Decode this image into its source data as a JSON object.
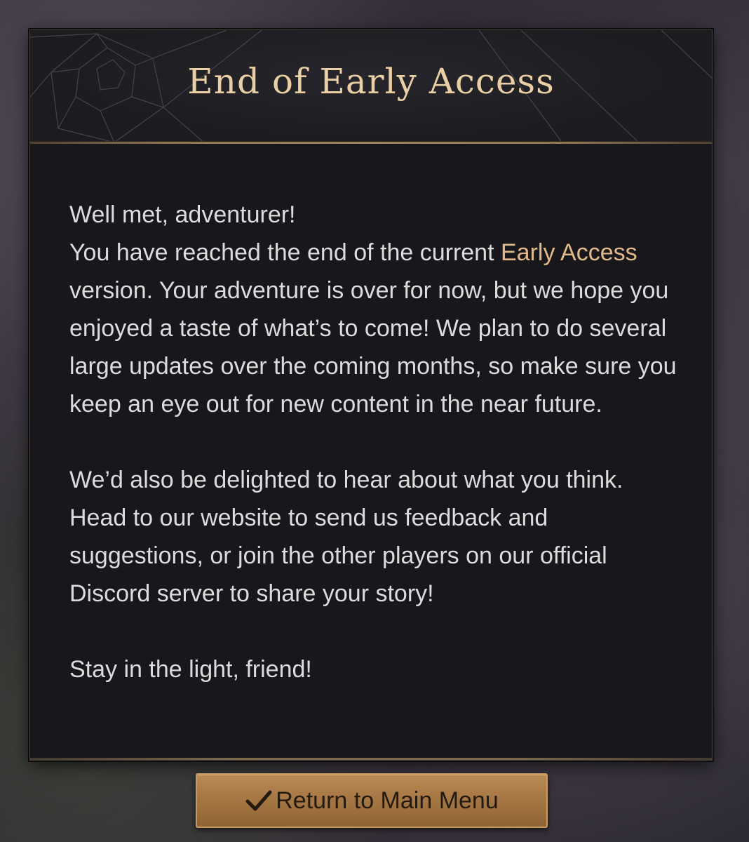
{
  "dialog": {
    "title": "End of Early Access",
    "greeting": "Well met, adventurer!",
    "para1_before": "You have reached the end of the current ",
    "para1_highlight": "Early Access",
    "para1_after": " version. Your adventure is over for now, but we hope you enjoyed a taste of what’s to come! We plan to do several large updates over the coming months, so make sure you keep an eye out for new content in the near future.",
    "para2": "We’d also be delighted to hear about what you think. Head to our website to send us feedback and suggestions, or join the other players on our official Discord server to share your story!",
    "closing": "Stay in the light, friend!"
  },
  "button": {
    "icon": "checkmark-icon",
    "label": "Return to Main Menu"
  },
  "colors": {
    "title": "#e9cfa3",
    "highlight": "#e2b98a",
    "body_text": "#dcdcdc",
    "panel": "#17171c",
    "button": "#a77845"
  }
}
